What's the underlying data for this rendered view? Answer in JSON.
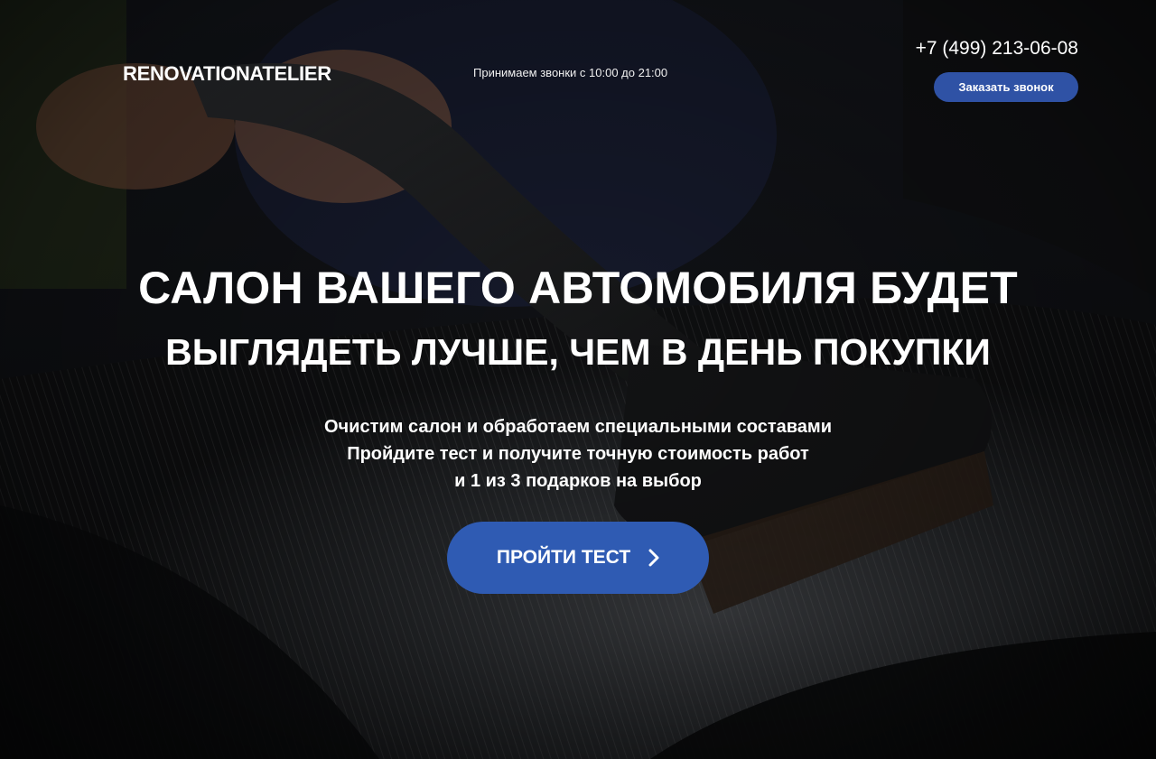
{
  "header": {
    "logo": "RENOVATIONATELIER",
    "hours": "Принимаем звонки с 10:00 до 21:00",
    "phone": "+7 (499) 213-06-08",
    "callback_label": "Заказать звонок"
  },
  "hero": {
    "title_line1": "САЛОН ВАШЕГО АВТОМОБИЛЯ БУДЕТ",
    "title_line2": "ВЫГЛЯДЕТЬ ЛУЧШЕ, ЧЕМ В ДЕНЬ ПОКУПКИ",
    "subtitle_line1": "Очистим салон и обработаем специальными составами",
    "subtitle_line2": "Пройдите тест и получите точную стоимость работ",
    "subtitle_line3": "и 1 из 3 подарков на выбор",
    "cta_label": "ПРОЙТИ ТЕСТ",
    "cta_icon": "chevron-right-icon"
  },
  "colors": {
    "accent": "#2f5bb3",
    "accent_dark": "#2f52a5"
  }
}
